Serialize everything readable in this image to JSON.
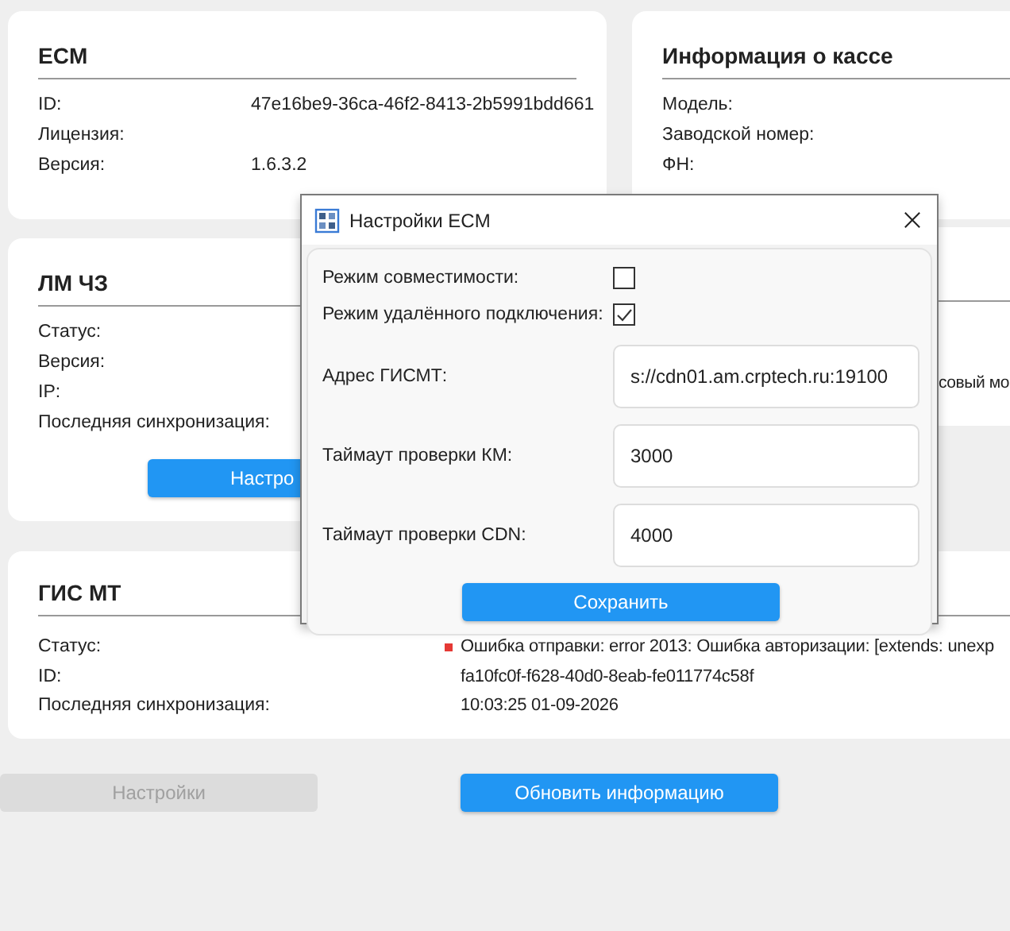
{
  "ecm": {
    "title": "ECM",
    "rows": [
      {
        "label": "ID:",
        "value": "47e16be9-36ca-46f2-8413-2b5991bdd661"
      },
      {
        "label": "Лицензия:"
      },
      {
        "label": "Версия:",
        "value": "1.6.3.2"
      }
    ]
  },
  "cash_info": {
    "title": "Информация о кассе",
    "rows": [
      {
        "label": "Модель:"
      },
      {
        "label": "Заводской номер:"
      },
      {
        "label": "ФН:"
      }
    ]
  },
  "lm_cz": {
    "title": "ЛМ ЧЗ",
    "rows": [
      {
        "label": "Статус:"
      },
      {
        "label": "Версия:"
      },
      {
        "label": "IP:"
      },
      {
        "label": "Последняя синхронизация:"
      }
    ],
    "button": "Настро"
  },
  "side_panel": {
    "text": "совый мо"
  },
  "gis_mt": {
    "title": "ГИС МТ",
    "rows": [
      {
        "label": "Статус:",
        "value": "Ошибка отправки: error 2013: Ошибка авторизации: [extends: unexp",
        "color": "#e53935"
      },
      {
        "label": "ID:",
        "value": "fa10fc0f-f628-40d0-8eab-fe011774c58f"
      },
      {
        "label": "Последняя синхронизация:",
        "value": "10:03:25 01-09-2026"
      }
    ]
  },
  "buttons": [
    {
      "label": "Настройки",
      "disabled": true
    },
    {
      "label": "Обновить информацию",
      "disabled": false
    }
  ],
  "dialog": {
    "title": "Настройки ECM",
    "settings": [
      {
        "kind": "checkbox",
        "label": "Режим совместимости:",
        "checked": false
      },
      {
        "kind": "checkbox",
        "label": "Режим удалённого подключения:",
        "checked": true
      },
      {
        "kind": "field",
        "label": "Адрес ГИСМТ:",
        "value": "s://cdn01.am.crptech.ru:19100"
      },
      {
        "kind": "field",
        "label": "Таймаут проверки КМ:",
        "value": "3000"
      },
      {
        "kind": "field",
        "label": "Таймаут проверки CDN:",
        "value": "4000"
      }
    ],
    "save_button": "Сохранить"
  }
}
